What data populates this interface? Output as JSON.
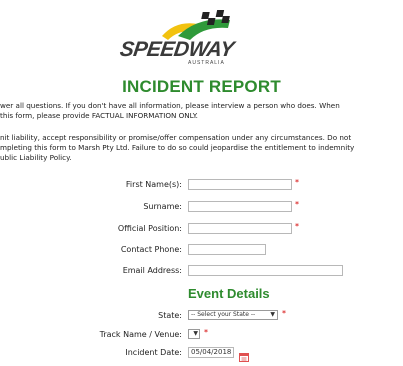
{
  "logo": {
    "word": "SPEEDWAY",
    "sub": "AUSTRALIA"
  },
  "title": "INCIDENT REPORT",
  "intro": {
    "line1": "wer all questions. If you don't have all information, please interview a person who does. When",
    "line2": "this form, please provide FACTUAL INFORMATION ONLY.",
    "line3": "nit liability, accept responsibility or promise/offer compensation under any circumstances. Do not",
    "line4": "mpleting this form to Marsh Pty Ltd. Failure to do so could jeopardise the entitlement to indemnity",
    "line5": "ublic Liability Policy."
  },
  "personal": {
    "first_name_label": "First Name(s):",
    "surname_label": "Surname:",
    "position_label": "Official Position:",
    "phone_label": "Contact Phone:",
    "email_label": "Email Address:",
    "required_mark": "*"
  },
  "event": {
    "heading": "Event Details",
    "state_label": "State:",
    "state_value": "-- Select your State --",
    "track_label": "Track Name / Venue:",
    "date_label": "Incident Date:",
    "date_value": "05/04/2018"
  },
  "colors": {
    "accent_green": "#2e8b2e",
    "required_red": "#d40000",
    "calendar_red": "#e05050"
  }
}
